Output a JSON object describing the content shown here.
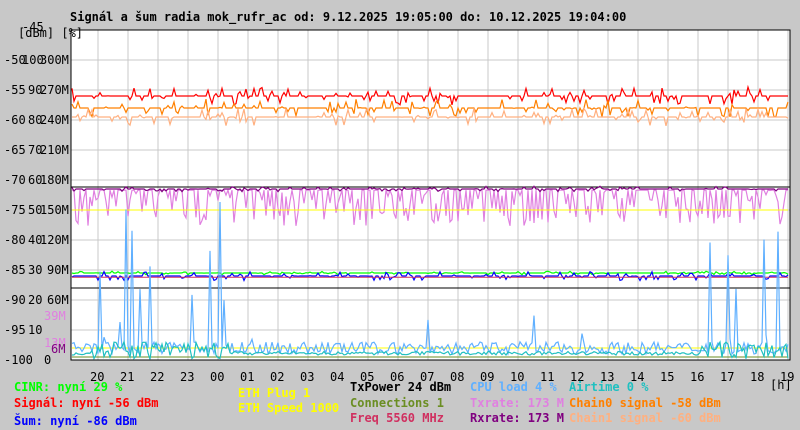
{
  "chart_data": {
    "type": "line",
    "title": "Signál a šum radia mok_rufr_ac od: 9.12.2025 19:05:00 do: 10.12.2025 19:04:00",
    "ylabel": "[dBm] [%]",
    "xlabel": "[h]",
    "top_label": "-45",
    "y_ticks_dbm": [
      "-50",
      "-55",
      "-60",
      "-65",
      "-70",
      "-75",
      "-80",
      "-85",
      "-90",
      "-95",
      "-100"
    ],
    "y_ticks_pct": [
      "100",
      "90",
      "80",
      "70",
      "60",
      "50",
      "40",
      "30",
      "20",
      "10",
      "0"
    ],
    "y_ticks_rate": [
      "300M",
      "270M",
      "240M",
      "210M",
      "180M",
      "150M",
      "120M",
      "90M",
      "60M"
    ],
    "y_extra_labels": [
      {
        "text": "39M",
        "color": "#e080e0"
      },
      {
        "text": "13M",
        "color": "#e080e0"
      },
      {
        "text": "6M",
        "color": "#800080"
      }
    ],
    "ylim_dbm": [
      -100,
      -45
    ],
    "x_ticks": [
      "20",
      "21",
      "22",
      "23",
      "00",
      "01",
      "02",
      "03",
      "04",
      "05",
      "06",
      "07",
      "08",
      "09",
      "10",
      "11",
      "12",
      "13",
      "14",
      "15",
      "16",
      "17",
      "18",
      "19"
    ],
    "grid": true,
    "series": [
      {
        "name": "Signál",
        "color": "#ff0000",
        "unit": "dBm",
        "level": -56,
        "jitter": 1
      },
      {
        "name": "Chain0 signal",
        "color": "#ff8000",
        "unit": "dBm",
        "level": -58,
        "jitter": 1
      },
      {
        "name": "Chain1 signal",
        "color": "#ffb080",
        "unit": "dBm",
        "level": -59.5,
        "jitter": 1
      },
      {
        "name": "Txrate",
        "color": "#e080e0",
        "unit": "dBm-scale",
        "level": -72,
        "jitter": 2
      },
      {
        "name": "Rxrate",
        "color": "#800080",
        "unit": "dBm-scale",
        "level": -71.5,
        "jitter": 0.3
      },
      {
        "name": "ETH Speed",
        "color": "#ffff00",
        "unit": "dBm-scale",
        "level": -75,
        "jitter": 0
      },
      {
        "name": "CINR",
        "color": "#00ff00",
        "unit": "dBm-scale",
        "level": -85.5,
        "jitter": 0.2
      },
      {
        "name": "Šum",
        "color": "#0000ff",
        "unit": "dBm",
        "level": -86,
        "jitter": 0.5
      },
      {
        "name": "Freq",
        "color": "#d03060",
        "unit": "dBm-scale",
        "level": -86.2,
        "jitter": 0
      },
      {
        "name": "ETH Plug",
        "color": "#ffff00",
        "unit": "dBm-scale",
        "level": -98,
        "jitter": 0
      },
      {
        "name": "Connections",
        "color": "#6b8e23",
        "unit": "dBm-scale",
        "level": -99.5,
        "jitter": 0
      },
      {
        "name": "CPU load",
        "color": "#60b0ff",
        "unit": "dBm-scale",
        "level": -98,
        "jitter": 1.5
      },
      {
        "name": "Airtime",
        "color": "#20c0c0",
        "unit": "dBm-scale",
        "level": -99,
        "jitter": 0.7
      }
    ],
    "legend": [
      {
        "text": "CINR: nyní 29 %",
        "color": "#00ff00"
      },
      {
        "text": "Signál: nyní -56 dBm",
        "color": "#ff0000"
      },
      {
        "text": "Šum: nyní -86 dBm",
        "color": "#0000ff"
      },
      {
        "text": "ETH Plug 1",
        "color": "#ffff00"
      },
      {
        "text": "ETH Speed 1000",
        "color": "#ffff00"
      },
      {
        "text": "TxPower 24 dBm",
        "color": "#000000"
      },
      {
        "text": "Connections 1",
        "color": "#6b8e23"
      },
      {
        "text": "Freq 5560 MHz",
        "color": "#d03060"
      },
      {
        "text": "CPU load 4 %",
        "color": "#60b0ff"
      },
      {
        "text": "Txrate: 173 M",
        "color": "#e080e0"
      },
      {
        "text": "Rxrate: 173 M",
        "color": "#800080"
      },
      {
        "text": "Airtime 0 %",
        "color": "#20c0c0"
      },
      {
        "text": "Chain0 signal -58 dBm",
        "color": "#ff8000"
      },
      {
        "text": "Chain1 signal -60 dBm",
        "color": "#ffb080"
      }
    ]
  }
}
